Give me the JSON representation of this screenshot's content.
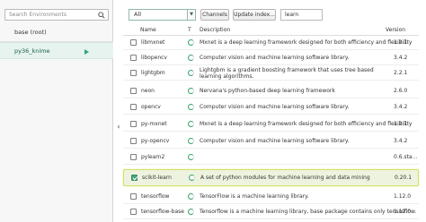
{
  "sidebar": {
    "search_placeholder": "Search Environments",
    "environments": [
      {
        "name": "base (root)"
      },
      {
        "name": "py36_knime"
      }
    ]
  },
  "toolbar": {
    "filter_value": "All",
    "channels_label": "Channels",
    "update_label": "Update index...",
    "search_value": "learn"
  },
  "table": {
    "headers": {
      "name": "Name",
      "type": "T",
      "description": "Description",
      "version": "Version"
    },
    "rows": [
      {
        "name": "libmxnet",
        "description": "Mxnet is a deep learning framework designed for both efficiency and flexibility",
        "version": "1.2.1",
        "checked": false,
        "installed": true
      },
      {
        "name": "libopencv",
        "description": "Computer vision and machine learning software library.",
        "version": "3.4.2",
        "checked": false,
        "installed": true
      },
      {
        "name": "lightgbm",
        "description": "Lightgbm is a gradient boosting framework that uses tree based learning algorithms.",
        "version": "2.2.1",
        "checked": false,
        "installed": true
      },
      {
        "name": "neon",
        "description": "Nervana's python-based deep learning framework",
        "version": "2.6.0",
        "checked": false,
        "installed": true
      },
      {
        "name": "opencv",
        "description": "Computer vision and machine learning software library.",
        "version": "3.4.2",
        "checked": false,
        "installed": true
      },
      {
        "name": "py-mxnet",
        "description": "Mxnet is a deep learning framework designed for both efficiency and flexibility",
        "version": "1.2.1",
        "checked": false,
        "installed": true
      },
      {
        "name": "py-opencv",
        "description": "Computer vision and machine learning software library.",
        "version": "3.4.2",
        "checked": false,
        "installed": true
      },
      {
        "name": "pylearn2",
        "description": "",
        "version": "0.6.sta...",
        "checked": false,
        "installed": true
      },
      {
        "name": "scikit-learn",
        "description": "A set of python modules for machine learning and data mining",
        "version": "0.20.1",
        "checked": true,
        "installed": true
      },
      {
        "name": "tensorflow",
        "description": "TensorFlow is a machine learning library.",
        "version": "1.12.0",
        "checked": false,
        "installed": true
      },
      {
        "name": "tensorflow-base",
        "description": "Tensorflow is a machine learning library, base package contains only tensorflow.",
        "version": "1.12.0",
        "checked": false,
        "installed": true
      }
    ]
  },
  "colors": {
    "accent": "#2ea57a",
    "highlight_border": "#d3e06a",
    "selected_env_bg": "#e6f3ee"
  }
}
